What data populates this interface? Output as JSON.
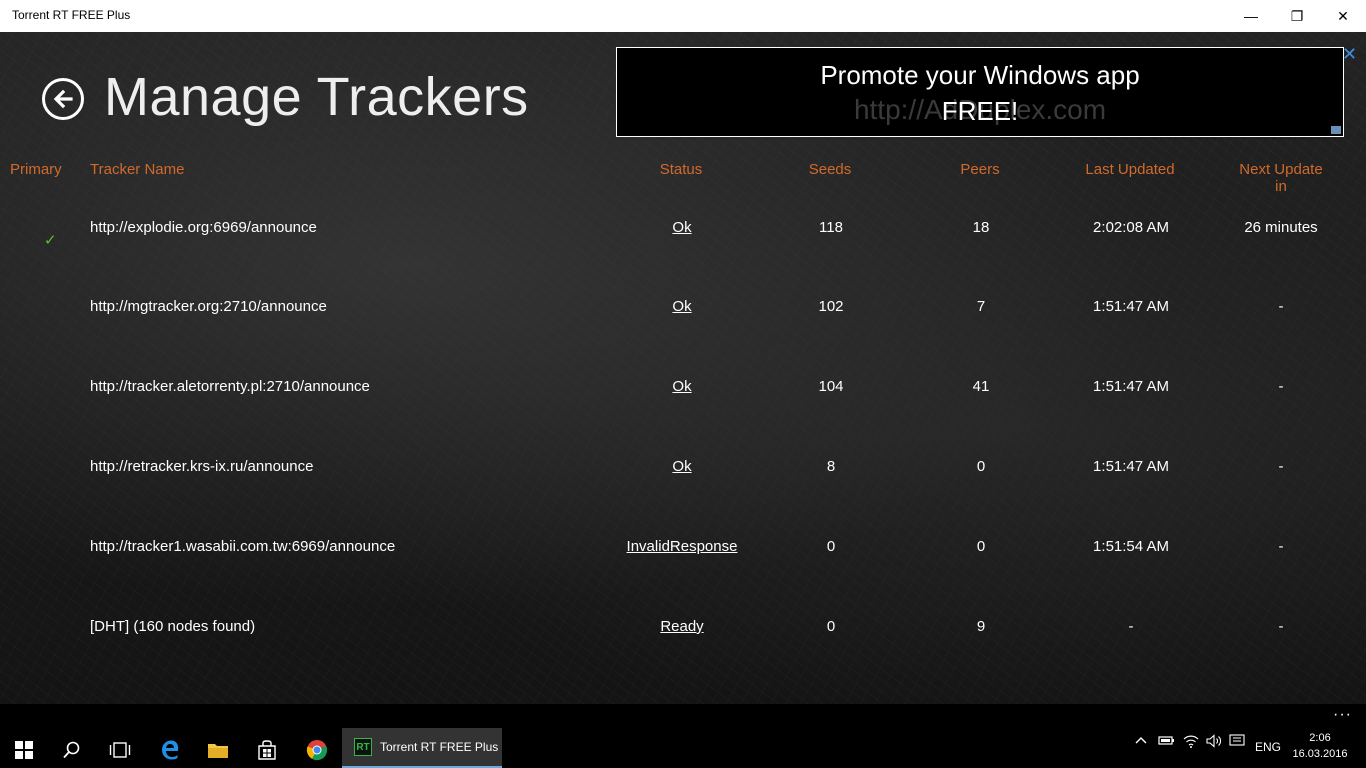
{
  "window": {
    "title": "Torrent RT FREE Plus",
    "minimize": "—",
    "maximize": "❐",
    "close": "✕"
  },
  "page": {
    "title": "Manage Trackers"
  },
  "ad": {
    "line1": "Promote your Windows app",
    "line2": "FREE!",
    "ghost": "http://AdDuplex.com",
    "close": "✕"
  },
  "table": {
    "headers": {
      "primary": "Primary",
      "name": "Tracker Name",
      "status": "Status",
      "seeds": "Seeds",
      "peers": "Peers",
      "last_updated": "Last Updated",
      "next_update": "Next Update in"
    },
    "rows": [
      {
        "primary": true,
        "name": "http://explodie.org:6969/announce",
        "status": "Ok",
        "seeds": "118",
        "peers": "18",
        "last_updated": "2:02:08 AM",
        "next_update": "26 minutes"
      },
      {
        "primary": false,
        "name": "http://mgtracker.org:2710/announce",
        "status": "Ok",
        "seeds": "102",
        "peers": "7",
        "last_updated": "1:51:47 AM",
        "next_update": "-"
      },
      {
        "primary": false,
        "name": "http://tracker.aletorrenty.pl:2710/announce",
        "status": "Ok",
        "seeds": "104",
        "peers": "41",
        "last_updated": "1:51:47 AM",
        "next_update": "-"
      },
      {
        "primary": false,
        "name": "http://retracker.krs-ix.ru/announce",
        "status": "Ok",
        "seeds": "8",
        "peers": "0",
        "last_updated": "1:51:47 AM",
        "next_update": "-"
      },
      {
        "primary": false,
        "name": "http://tracker1.wasabii.com.tw:6969/announce",
        "status": "InvalidResponse",
        "seeds": "0",
        "peers": "0",
        "last_updated": "1:51:54 AM",
        "next_update": "-"
      },
      {
        "primary": false,
        "name": "[DHT] (160 nodes found)",
        "status": "Ready",
        "seeds": "0",
        "peers": "9",
        "last_updated": "-",
        "next_update": "-"
      }
    ]
  },
  "check_glyph": "✓",
  "taskbar": {
    "dots": "···",
    "app_label": "Torrent RT FREE Plus",
    "app_icon_text": "RT",
    "language": "ENG",
    "time": "2:06",
    "date": "16.03.2016",
    "icons": [
      "windows-start-icon",
      "search-icon",
      "task-view-icon",
      "edge-icon",
      "file-explorer-icon",
      "store-icon",
      "chrome-icon"
    ]
  },
  "colors": {
    "accent": "#d06a2c",
    "check": "#5fbf2a",
    "ad_close": "#3a8fe0"
  }
}
